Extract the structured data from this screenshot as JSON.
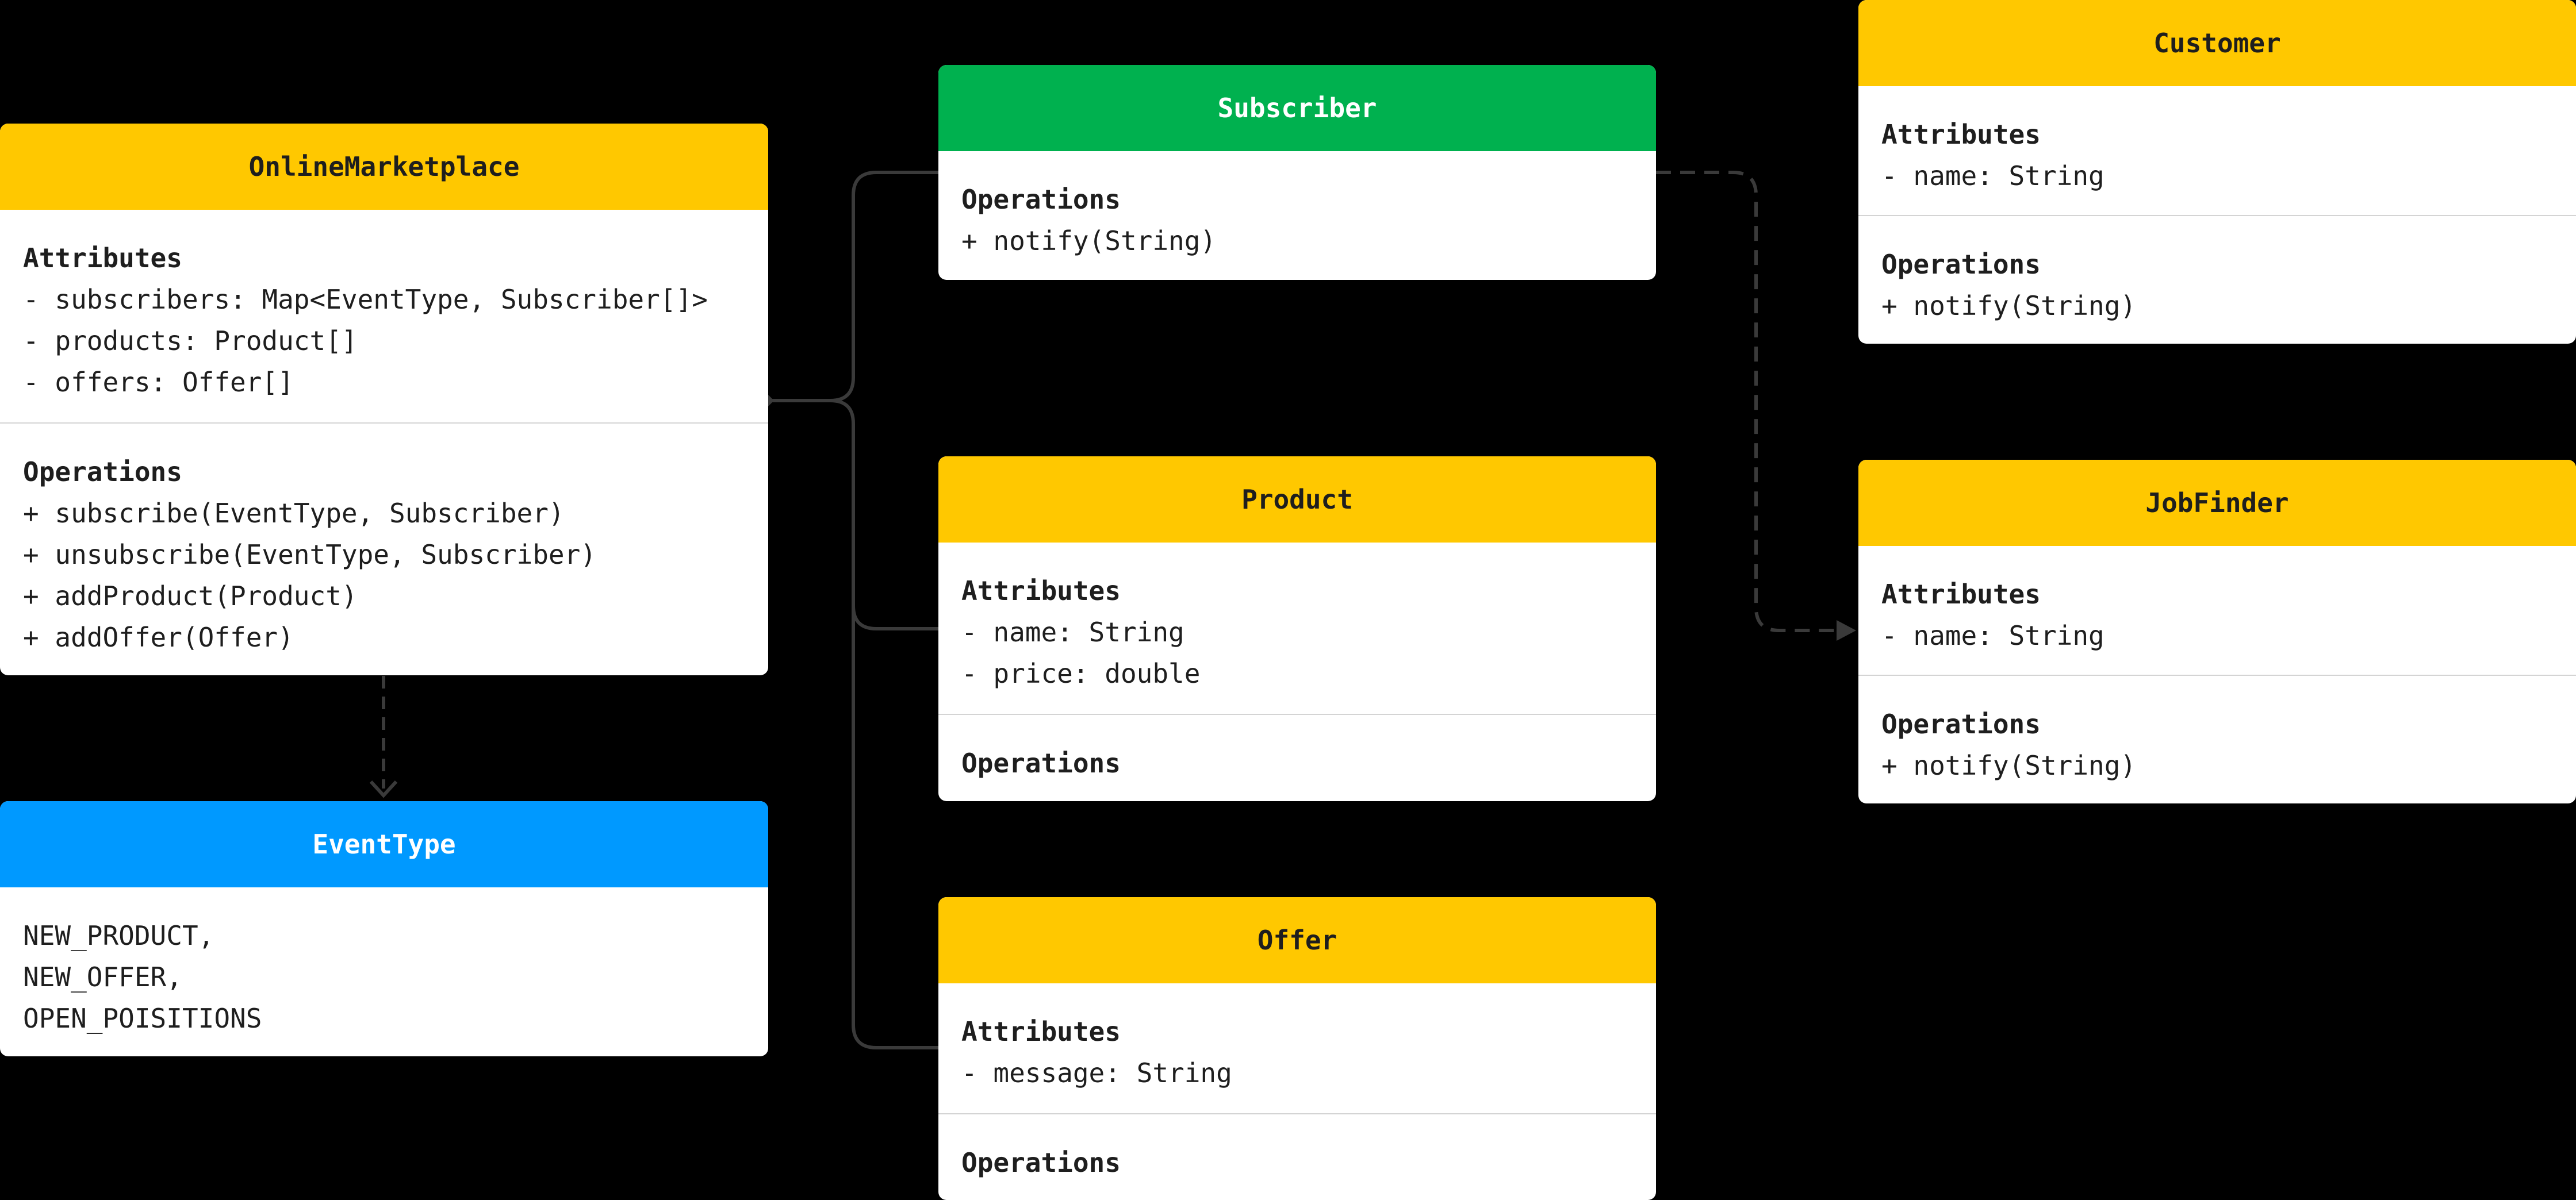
{
  "diagram": {
    "classes": {
      "online_marketplace": {
        "name": "OnlineMarketplace",
        "header_color": "#ffc800",
        "attributes_title": "Attributes",
        "attributes": [
          "- subscribers: Map<EventType, Subscriber[]>",
          "- products: Product[]",
          "- offers: Offer[]"
        ],
        "operations_title": "Operations",
        "operations": [
          "+ subscribe(EventType, Subscriber)",
          "+ unsubscribe(EventType, Subscriber)",
          "+ addProduct(Product)",
          "+ addOffer(Offer)"
        ]
      },
      "event_type": {
        "name": "EventType",
        "header_color": "#0099ff",
        "values": [
          "NEW_PRODUCT,",
          "NEW_OFFER,",
          "OPEN_POISITIONS"
        ]
      },
      "subscriber": {
        "name": "Subscriber",
        "header_color": "#00b14f",
        "operations_title": "Operations",
        "operations": [
          "+ notify(String)"
        ]
      },
      "product": {
        "name": "Product",
        "header_color": "#ffc800",
        "attributes_title": "Attributes",
        "attributes": [
          "- name: String",
          "- price: double"
        ],
        "operations_title": "Operations",
        "operations": []
      },
      "offer": {
        "name": "Offer",
        "header_color": "#ffc800",
        "attributes_title": "Attributes",
        "attributes": [
          "- message: String"
        ],
        "operations_title": "Operations",
        "operations": []
      },
      "customer": {
        "name": "Customer",
        "header_color": "#ffc800",
        "attributes_title": "Attributes",
        "attributes": [
          "- name: String"
        ],
        "operations_title": "Operations",
        "operations": [
          "+ notify(String)"
        ]
      },
      "job_finder": {
        "name": "JobFinder",
        "header_color": "#ffc800",
        "attributes_title": "Attributes",
        "attributes": [
          "- name: String"
        ],
        "operations_title": "Operations",
        "operations": [
          "+ notify(String)"
        ]
      }
    },
    "relations": [
      {
        "from": "OnlineMarketplace",
        "to": "Subscriber",
        "kind": "aggregation"
      },
      {
        "from": "OnlineMarketplace",
        "to": "Product",
        "kind": "aggregation"
      },
      {
        "from": "OnlineMarketplace",
        "to": "Offer",
        "kind": "aggregation"
      },
      {
        "from": "OnlineMarketplace",
        "to": "EventType",
        "kind": "dependency"
      },
      {
        "from": "Customer",
        "to": "Subscriber",
        "kind": "realization"
      },
      {
        "from": "JobFinder",
        "to": "Subscriber",
        "kind": "realization"
      }
    ],
    "connector_color": "#3a3a3a"
  }
}
